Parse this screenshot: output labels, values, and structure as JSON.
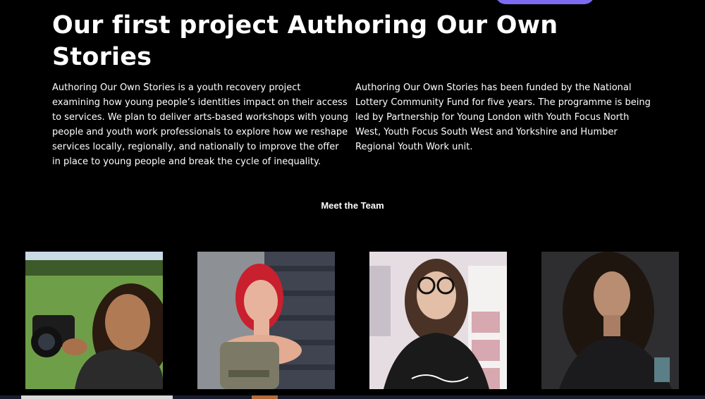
{
  "intro": {
    "headline": "Our first project Authoring Our Own Stories",
    "paragraph_left": "Authoring Our Own Stories is a youth recovery project examining how young people’s identities impact on their access to services. We plan to deliver arts-based workshops with young people and youth work professionals to explore how we reshape services locally, regionally, and nationally to improve the offer in place to young people and break the cycle of inequality.",
    "paragraph_right": "Authoring Our Own Stories has been funded by the National Lottery Community Fund for five years. The programme is being led by Partnership for Young London with Youth Focus North West, Youth Focus South West and Yorkshire and Humber Regional Youth Work unit."
  },
  "team": {
    "heading": "Meet the Team",
    "members": [
      {
        "photo": "team-member-photo-camera"
      },
      {
        "photo": "team-member-photo-red-hair"
      },
      {
        "photo": "team-member-photo-glasses"
      },
      {
        "photo": "team-member-photo-curly-hair"
      }
    ]
  },
  "colors": {
    "background": "#000000",
    "text": "#ffffff",
    "accent_pill": "#7d6cf0"
  }
}
